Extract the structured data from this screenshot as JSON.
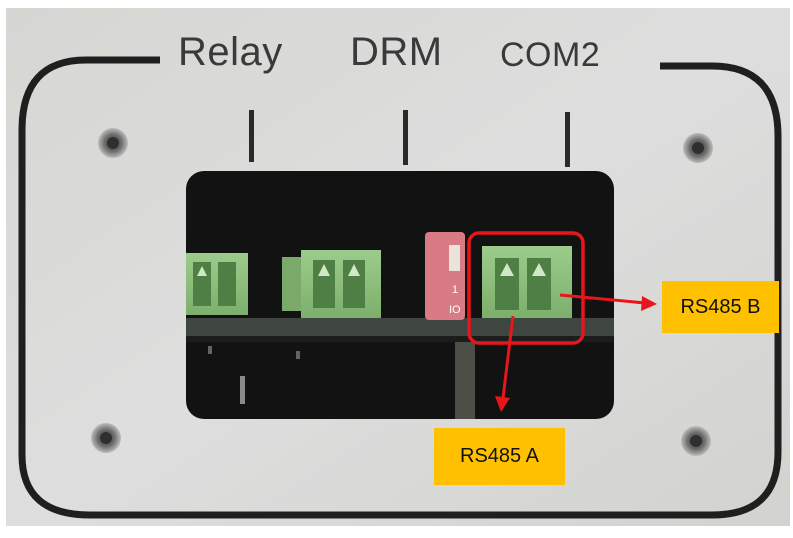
{
  "panel": {
    "labels": {
      "relay": "Relay",
      "drm": "DRM",
      "com2": "COM2"
    },
    "dip_switch_marks": [
      "1",
      "IO"
    ]
  },
  "callouts": {
    "rs485_b": "RS485 B",
    "rs485_a": "RS485 A"
  },
  "colors": {
    "panel": "#dcdcda",
    "panel_outline": "#1f1f1f",
    "cutout": "#121212",
    "terminal_green": "#8fbe7e",
    "dip_switch_red": "#d97b85",
    "highlight_red": "#e8161b",
    "callout_fill": "#ffc000",
    "callout_text": "#111111"
  }
}
